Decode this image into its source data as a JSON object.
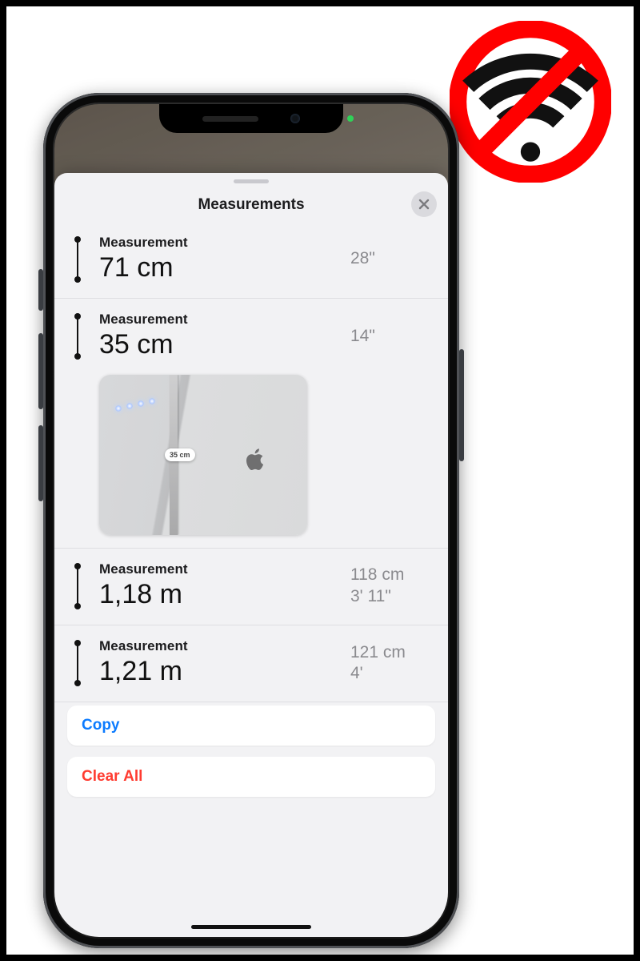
{
  "sheet": {
    "title": "Measurements",
    "close_icon": "close-icon"
  },
  "measurements": [
    {
      "label": "Measurement",
      "primary": "71 cm",
      "secondary1": "28\"",
      "secondary2": ""
    },
    {
      "label": "Measurement",
      "primary": "35 cm",
      "secondary1": "14\"",
      "secondary2": "",
      "thumbnail_badge": "35 cm"
    },
    {
      "label": "Measurement",
      "primary": "1,18 m",
      "secondary1": "118 cm",
      "secondary2": "3' 11\""
    },
    {
      "label": "Measurement",
      "primary": "1,21 m",
      "secondary1": "121 cm",
      "secondary2": "4'"
    }
  ],
  "actions": {
    "copy": "Copy",
    "clear_all": "Clear All"
  },
  "overlay": {
    "no_wifi_icon": "no-wifi-icon"
  },
  "colors": {
    "accent_blue": "#0b7bff",
    "destructive_red": "#ff3b30",
    "sheet_bg": "#f2f2f4",
    "secondary_text": "#8a8a8e"
  }
}
